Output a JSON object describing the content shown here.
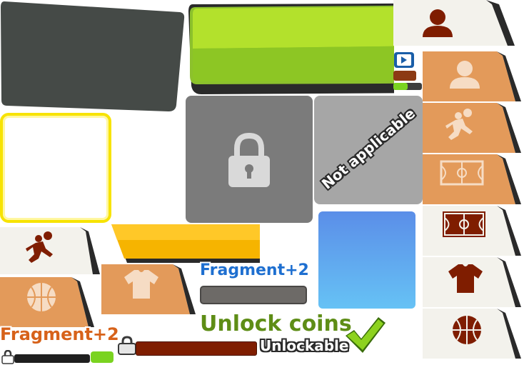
{
  "labels": {
    "not_applicable": "Not applicable",
    "fragment_blue": "Fragment+2",
    "fragment_orange": "Fragment+2",
    "unlock_coins": "Unlock coins",
    "unlockable": "Unlockable"
  },
  "colors": {
    "dark_panel": "#454a47",
    "green_button": "#9ccc15",
    "yellow_frame": "#f7e300",
    "gray_locked": "#7b7b7b",
    "gray_na": "#a6a6a6",
    "orange_tab": "#e39a5a",
    "cream_tab": "#f3f2ec",
    "brown_icon": "#7f1d00",
    "blue_square_top": "#5b8ee8",
    "blue_square_bottom": "#66c2f5",
    "gold_bar": "#f6b400"
  },
  "icons": {
    "tabs_right": [
      "person-icon",
      "person-icon",
      "basketball-player-icon",
      "basketball-court-icon",
      "basketball-court-icon",
      "tshirt-icon",
      "basketball-icon"
    ],
    "tabs_left": [
      "basketball-player-icon",
      "basketball-icon",
      "tshirt-icon"
    ],
    "lock": "padlock-icon",
    "check": "checkmark-icon",
    "play": "play-icon"
  }
}
